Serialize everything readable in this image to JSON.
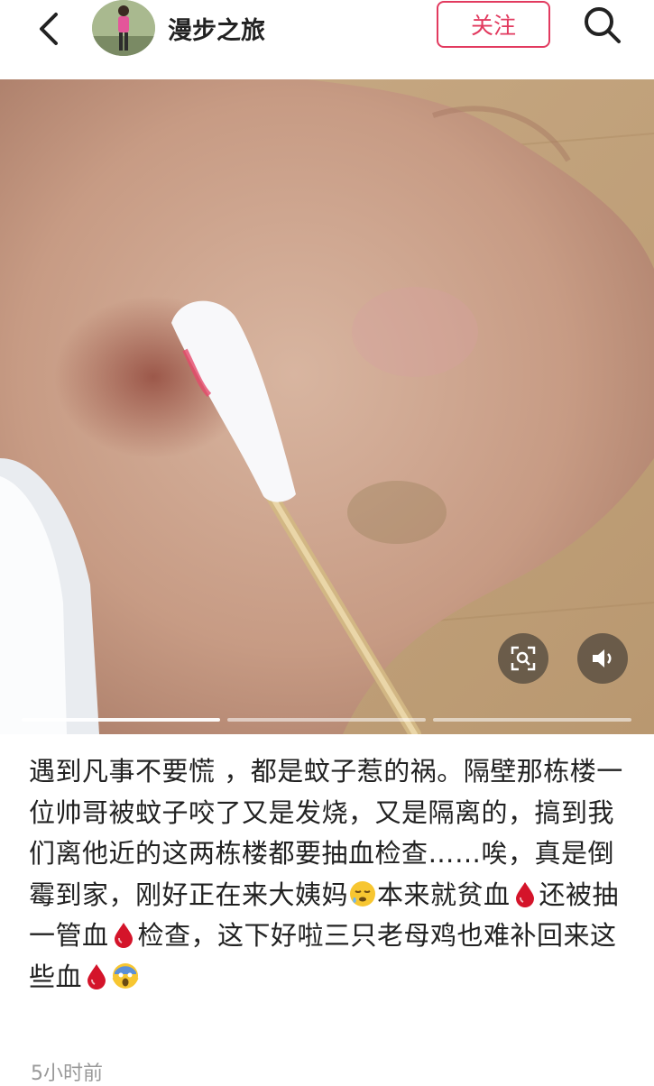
{
  "header": {
    "author_name": "漫步之旅",
    "follow_label": "关注",
    "icons": [
      "back-arrow-icon",
      "search-icon"
    ]
  },
  "media": {
    "image_description_icons": [
      "scan-icon",
      "volume-icon"
    ],
    "page_count": 3,
    "active_page": 1
  },
  "post": {
    "text_parts": [
      "遇到凡事不要慌 ，都是蚊子惹的祸。隔壁那栋楼一位帅哥被蚊子咬了又是发烧，又是隔离的，搞到我们离他近的这两栋楼都要抽血检查……唉，真是倒霉到家，刚好正在来大姨妈",
      "本来就贫血",
      "还被抽一管血",
      "检查，这下好啦三只老母鸡也难补回来这些血"
    ],
    "emojis": [
      "sleepy-face-emoji",
      "blood-drop-emoji",
      "blood-drop-emoji",
      "blood-drop-emoji",
      "fear-scream-emoji"
    ],
    "time": "5小时前"
  },
  "colors": {
    "accent": "#e23a5f",
    "text": "#222222",
    "muted": "#999999"
  }
}
